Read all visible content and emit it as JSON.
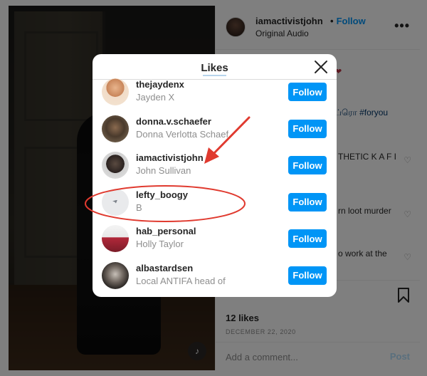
{
  "post_panel": {
    "username": "iamactivistjohn",
    "dot": "•",
    "follow_label": "Follow",
    "audio_label": "Original Audio",
    "more_label": "•••",
    "caption_fragments": [
      "ப்ரொ #foryou",
      "THETIC K A F I",
      "rn loot murder",
      "o work at the"
    ],
    "likes_count": "12 likes",
    "date": "DECEMBER 22, 2020",
    "comment_placeholder": "Add a comment...",
    "post_label": "Post"
  },
  "likes_modal": {
    "title": "Likes",
    "users": [
      {
        "username": "thejaydenx",
        "fullname": "Jayden X",
        "follow_label": "Follow"
      },
      {
        "username": "donna.v.schaefer",
        "fullname": "Donna Verlotta Schaefe",
        "follow_label": "Follow"
      },
      {
        "username": "iamactivistjohn",
        "fullname": "John Sullivan",
        "follow_label": "Follow"
      },
      {
        "username": "lefty_boogy",
        "fullname": "B",
        "follow_label": "Follow"
      },
      {
        "username": "hab_personal",
        "fullname": "Holly Taylor",
        "follow_label": "Follow"
      },
      {
        "username": "albastardsen",
        "fullname": "Local ANTIFA head of HR",
        "follow_label": "Follow"
      }
    ]
  },
  "colors": {
    "follow_blue": "#0095f6",
    "annotation_red": "#e03a2f"
  },
  "icons": [
    "close-icon",
    "more-icon",
    "heart-icon",
    "bookmark-icon",
    "volume-icon"
  ]
}
